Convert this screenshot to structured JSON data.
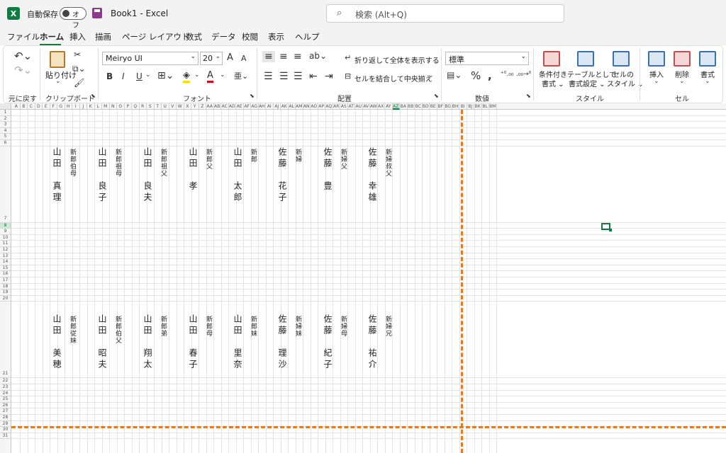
{
  "titlebar": {
    "app_logo": "X",
    "autosave_label": "自動保存",
    "autosave_state": "オフ",
    "doc_title": "Book1  -  Excel",
    "search_placeholder": "検索 (Alt+Q)"
  },
  "menu": [
    "ファイル",
    "ホーム",
    "挿入",
    "描画",
    "ページ レイアウト",
    "数式",
    "データ",
    "校閲",
    "表示",
    "ヘルプ"
  ],
  "ribbon": {
    "undo_label": "元に戻す",
    "paste_label": "貼り付け",
    "clipboard_label": "クリップボード",
    "font_name": "Meiryo UI",
    "font_size": "20",
    "font_label": "フォント",
    "wrap_text": "折り返して全体を表示する",
    "merge_center": "セルを結合して中央揃え",
    "alignment_label": "配置",
    "number_format": "標準",
    "number_label": "数値",
    "cond_format": [
      "条件付き",
      "書式 ⌄"
    ],
    "table_format": [
      "テーブルとして",
      "書式設定 ⌄"
    ],
    "cell_styles": [
      "セルの",
      "スタイル ⌄"
    ],
    "style_label": "スタイル",
    "insert_label": "挿入",
    "delete_label": "削除",
    "format_label": "書式",
    "cells_label": "セル",
    "bold": "B",
    "italic": "I",
    "underline": "U",
    "grow": "A",
    "shrink": "A"
  },
  "columns": [
    "A",
    "B",
    "C",
    "D",
    "E",
    "F",
    "G",
    "H",
    "I",
    "J",
    "K",
    "L",
    "M",
    "N",
    "O",
    "P",
    "Q",
    "R",
    "S",
    "T",
    "U",
    "V",
    "W",
    "X",
    "Y",
    "Z",
    "AA",
    "AB",
    "AC",
    "AD",
    "AE",
    "AF",
    "AG",
    "AH",
    "AI",
    "AJ",
    "AK",
    "AL",
    "AM",
    "AN",
    "AO",
    "AP",
    "AQ",
    "AR",
    "AS",
    "AT",
    "AU",
    "AV",
    "AW",
    "AX",
    "AY",
    "AZ",
    "BA",
    "BB",
    "BC",
    "BD",
    "BE",
    "BF",
    "BG",
    "BH",
    "BI",
    "BJ",
    "BK",
    "BL",
    "BM"
  ],
  "selected_column": "AZ",
  "rows": [
    "1",
    "2",
    "3",
    "4",
    "5",
    "6",
    "7",
    "8",
    "9",
    "10",
    "11",
    "12",
    "13",
    "14",
    "15",
    "16",
    "17",
    "18",
    "19",
    "20",
    "21",
    "22",
    "23",
    "24",
    "25",
    "26",
    "27",
    "28",
    "29",
    "30",
    "31"
  ],
  "selected_row": "8",
  "seating": {
    "row1": [
      {
        "name": "山田　真理",
        "role": "新郎伯母"
      },
      {
        "name": "山田　良子",
        "role": "新郎祖母"
      },
      {
        "name": "山田　良夫",
        "role": "新郎祖父"
      },
      {
        "name": "山田　孝",
        "role": "新郎父"
      },
      {
        "name": "山田　太郎",
        "role": "新郎"
      },
      {
        "name": "佐藤　花子",
        "role": "新婦"
      },
      {
        "name": "佐藤　豊",
        "role": "新婦父"
      },
      {
        "name": "佐藤　幸雄",
        "role": "新婦叔父"
      }
    ],
    "row2": [
      {
        "name": "山田　美穂",
        "role": "新郎従妹"
      },
      {
        "name": "山田　昭夫",
        "role": "新郎伯父"
      },
      {
        "name": "山田　翔太",
        "role": "新郎弟"
      },
      {
        "name": "山田　春子",
        "role": "新郎母"
      },
      {
        "name": "山田　里奈",
        "role": "新郎妹"
      },
      {
        "name": "佐藤　理沙",
        "role": "新婦妹"
      },
      {
        "name": "佐藤　紀子",
        "role": "新婦母"
      },
      {
        "name": "佐藤　祐介",
        "role": "新婦兄"
      }
    ]
  },
  "colors": {
    "excel_green": "#107c41",
    "page_break": "#e07b2a"
  }
}
